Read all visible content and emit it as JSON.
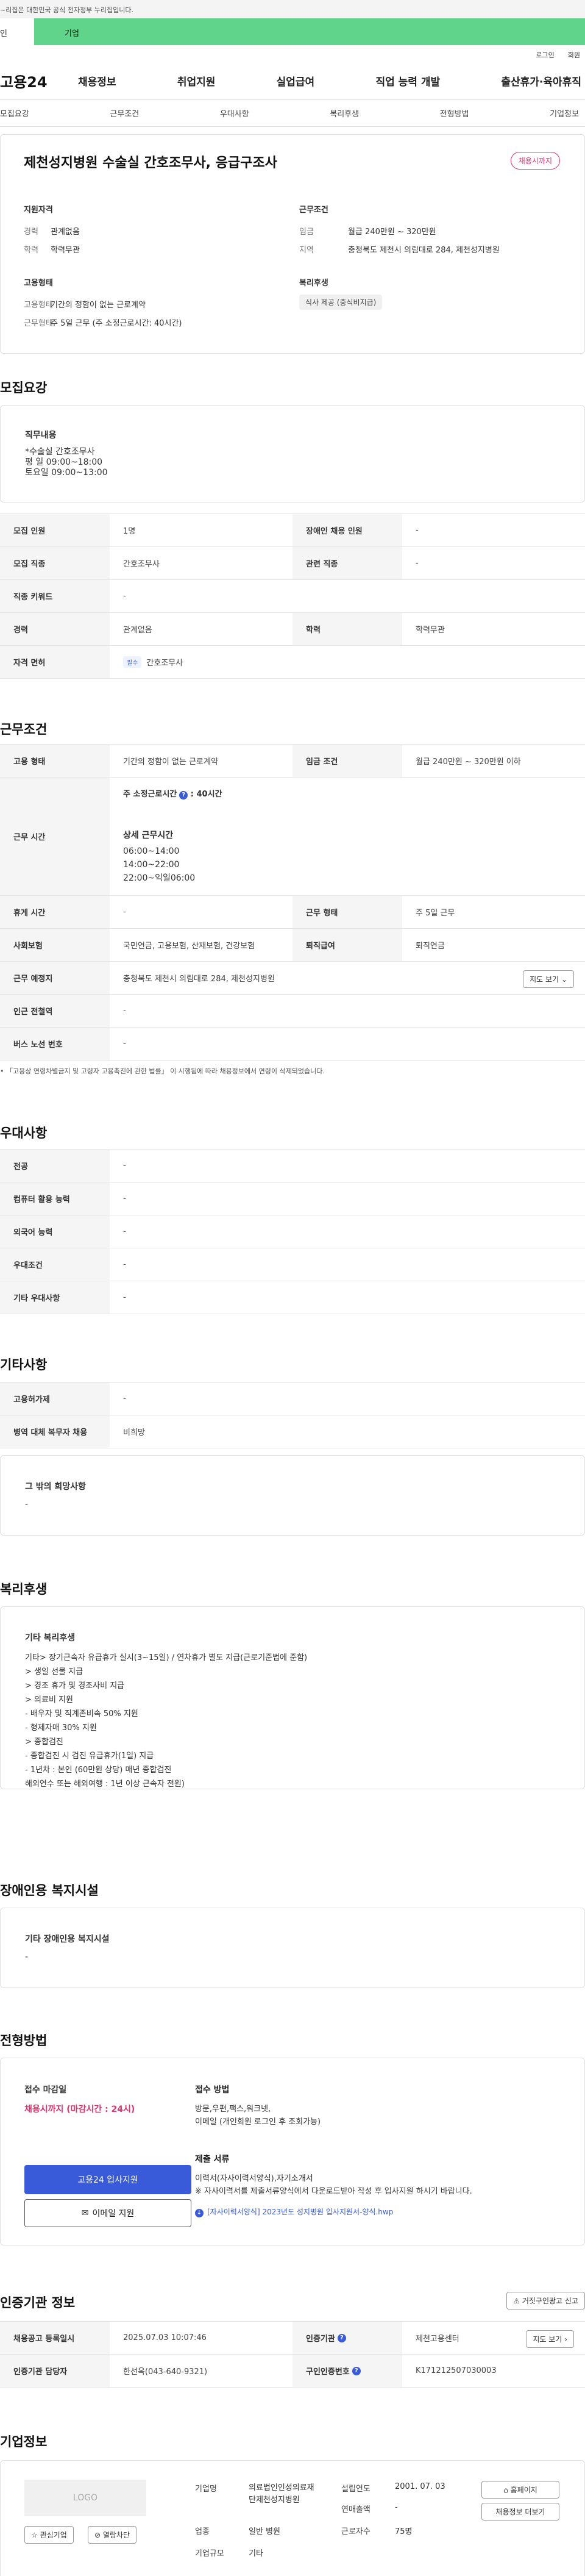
{
  "banner": {
    "text": "~리집은 대한민국 공식 전자정부 누리집입니다."
  },
  "tabs": [
    "인",
    "기업"
  ],
  "util_links": [
    "로그인",
    "회원"
  ],
  "logo": "고용24",
  "gnb": [
    "채용정보",
    "취업지원",
    "실업급여",
    "직업 능력 개발",
    "출산휴가·육아휴직"
  ],
  "subnav": [
    "모집요강",
    "근무조건",
    "우대사항",
    "복리후생",
    "전형방법",
    "기업정보"
  ],
  "job": {
    "title": "제천성지병원 수술실 간호조무사, 응급구조사",
    "status": "채용시까지",
    "qualification_label": "지원자격",
    "career_label": "경력",
    "career": "관계없음",
    "edu_label": "학력",
    "edu": "학력무관",
    "employment_label": "고용형태",
    "emp_type_label": "고용형태",
    "emp_type": "기간의 정함이 없는 근로계약",
    "work_type_label": "근무형태",
    "work_type": "주 5일 근무 (주 소정근로시간: 40시간)",
    "conditions_label": "근무조건",
    "wage_label": "임금",
    "wage": "월급 240만원 ~ 320만원",
    "region_label": "지역",
    "region": "충청북도 제천시 의림대로 284, 제천성지병원",
    "welfare_label": "복리후생",
    "welfare_chip": "식사 제공 (중식비지급)"
  },
  "recruit": {
    "heading": "모집요강",
    "duty_title": "직무내용",
    "duty_text": "*수술실 간호조무사\n평   일 09:00~18:00\n토요일 09:00~13:00",
    "table": {
      "count_k": "모집 인원",
      "count_v": "1명",
      "disabled_k": "장애인 채용 인원",
      "disabled_v": "-",
      "job_k": "모집 직종",
      "job_v": "간호조무사",
      "related_k": "관련 직종",
      "related_v": "-",
      "keyword_k": "직종 키워드",
      "keyword_v": "-",
      "career_k": "경력",
      "career_v": "관계없음",
      "edu_k": "학력",
      "edu_v": "학력무관",
      "license_k": "자격 면허",
      "license_tag": "필수",
      "license_v": "간호조무사"
    }
  },
  "conditions": {
    "heading": "근무조건",
    "emp_k": "고용 형태",
    "emp_v": "기간의 정함이 없는 근로계약",
    "wage_k": "임금 조건",
    "wage_v": "월급 240만원 ~ 320만원 이하",
    "time_k": "근무 시간",
    "time_weekly": "주 소정근로시간",
    "time_hours": "40시간",
    "time_detail_title": "상세 근무시간",
    "time_detail": "06:00~14:00\n14:00~22:00\n22:00~익일06:00",
    "holiday_k": "휴게 시간",
    "holiday_v": "-",
    "worktype_k": "근무 형태",
    "worktype_v": "주 5일 근무",
    "insurance_k": "사회보험",
    "insurance_v": "국민연금, 고용보험, 산재보험, 건강보험",
    "severance_k": "퇴직급여",
    "severance_v": "퇴직연금",
    "place_k": "근무 예정지",
    "place_v": "충청북도 제천시 의림대로 284, 제천성지병원",
    "map_btn": "지도 보기",
    "subway_k": "인근 전철역",
    "subway_v": "-",
    "bus_k": "버스 노선 번호",
    "bus_v": "-",
    "note": "「고용상 연령차별금지 및 고령자 고용촉진에 관한 법률」 이 시행됨에 따라 채용정보에서 연령이 삭제되었습니다."
  },
  "preferences": {
    "heading": "우대사항",
    "rows": [
      {
        "k": "전공",
        "v": "-"
      },
      {
        "k": "컴퓨터 활용 능력",
        "v": "-"
      },
      {
        "k": "외국어 능력",
        "v": "-"
      },
      {
        "k": "우대조건",
        "v": "-"
      },
      {
        "k": "기타 우대사항",
        "v": "-"
      }
    ]
  },
  "others": {
    "heading": "기타사항",
    "rows": [
      {
        "k": "고용허가제",
        "v": "-"
      },
      {
        "k": "병역 대체 복무자 채용",
        "v": "비희망"
      }
    ],
    "extra_title": "그 밖의 희망사항",
    "extra_text": "-"
  },
  "welfare": {
    "heading": "복리후생",
    "title": "기타 복리후생",
    "text": "기타> 장기근속자 유급휴가 실시(3~15일) / 연차휴가 별도 지급(근로기준법에 준함)\n> 생일 선물 지급\n> 경조 휴가 및 경조사비 지급\n> 의료비 지원\n- 배우자 및 직계존비속 50% 지원\n- 형제자매 30% 지원\n> 종합검진\n- 종합검진 시 검진 유급휴가(1일) 지급\n- 1년차 : 본인 (60만원 상당) 매년 종합검진\n해외연수 또는 해외여행 : 1년 이상 근속자 전원)"
  },
  "disabled": {
    "heading": "장애인용 복지시설",
    "title": "기타 장애인용 복지시설",
    "text": "-"
  },
  "selection": {
    "heading": "전형방법",
    "deadline_title": "접수 마감일",
    "deadline": "채용시까지 (마감시간 : 24시)",
    "method_title": "접수 방법",
    "method": "방문,우편,팩스,워크넷,\n이메일 (개인회원 로그인 후 조회가능)",
    "docs_title": "제출 서류",
    "docs": "이력서(자사이력서양식),자기소개서\n※ 자사이력서를 제출서류양식에서 다운로드받아 작성 후 입사지원 하시기 바랍니다.",
    "attachment": "[자사이력서양식] 2023년도 성지병원 입사지원서-양식.hwp",
    "apply_btn": "고용24 입사지원",
    "email_btn": "이메일 지원"
  },
  "cert": {
    "heading": "인증기관 정보",
    "report_btn": "거짓구인광고 신고",
    "reg_k": "채용공고 등록일시",
    "reg_v": "2025.07.03 10:07:46",
    "org_k": "인증기관",
    "org_v": "제천고용센터",
    "map_btn": "지도 보기",
    "mgr_k": "인증기관 담당자",
    "mgr_v": "한선옥(043-640-9321)",
    "id_k": "구인인증번호",
    "id_v": "K171212507030003"
  },
  "company": {
    "heading": "기업정보",
    "logo_text": "LOGO",
    "fav_btn": "관심기업",
    "block_btn": "열람차단",
    "name_k": "기업명",
    "name_v": "의료법인인성의료재단제천성지병원",
    "industry_k": "업종",
    "industry_v": "일반 병원",
    "size_k": "기업규모",
    "size_v": "기타",
    "founded_k": "설립연도",
    "founded_v": "2001. 07. 03",
    "sales_k": "연매출액",
    "sales_v": "-",
    "staff_k": "근로자수",
    "staff_v": "75명",
    "home_btn": "홈페이지",
    "jobs_btn": "채용정보 더보기"
  }
}
